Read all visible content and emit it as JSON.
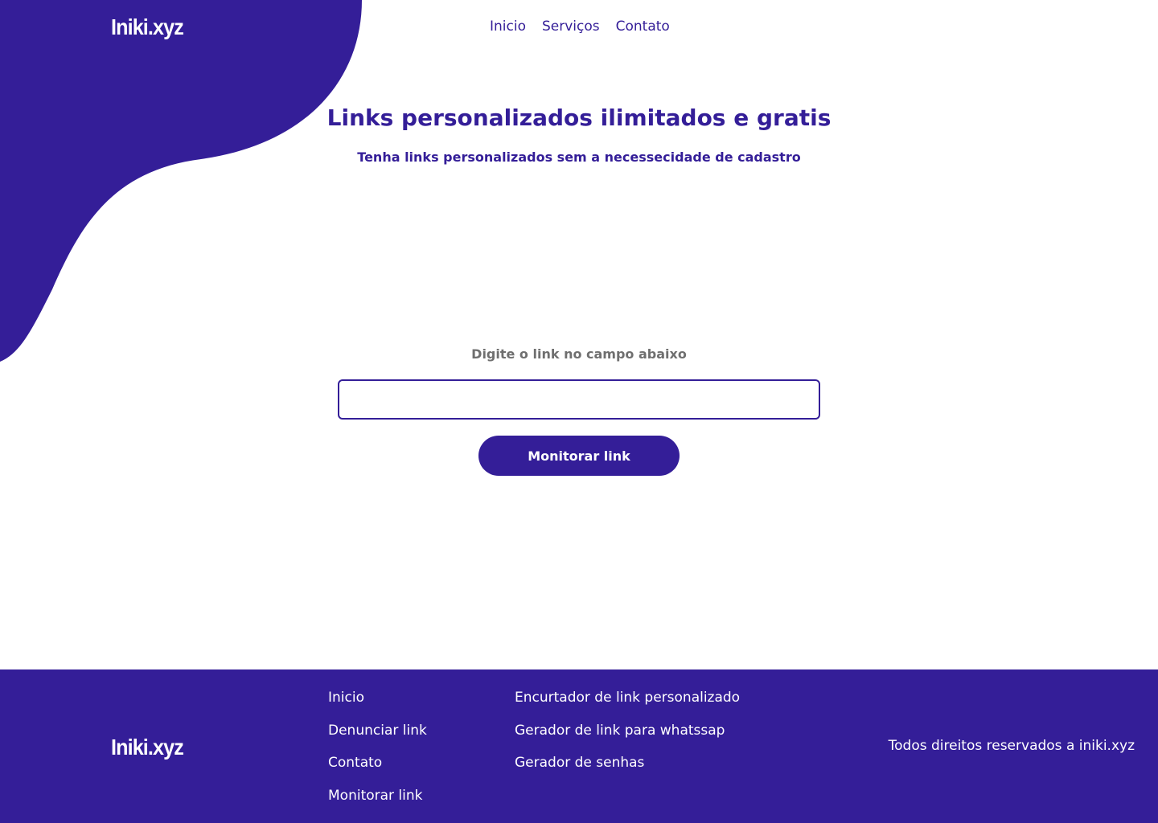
{
  "brand": {
    "name": "Iniki.xyz",
    "primary_color": "#341e98",
    "text_gray": "#6f6f6f"
  },
  "nav": {
    "items": [
      {
        "label": "Inicio"
      },
      {
        "label": "Serviços"
      },
      {
        "label": "Contato"
      }
    ]
  },
  "hero": {
    "title": "Links personalizados ilimitados e gratis",
    "subtitle": "Tenha links personalizados sem a necessecidade de cadastro"
  },
  "form": {
    "label": "Digite o link no campo abaixo",
    "input_value": "",
    "input_placeholder": "",
    "button_label": "Monitorar link"
  },
  "footer": {
    "brand": "Iniki.xyz",
    "col1": [
      {
        "label": "Inicio"
      },
      {
        "label": "Denunciar link"
      },
      {
        "label": "Contato"
      },
      {
        "label": "Monitorar link"
      }
    ],
    "col2": [
      {
        "label": "Encurtador de link personalizado"
      },
      {
        "label": "Gerador de link para whatssap"
      },
      {
        "label": "Gerador de senhas"
      }
    ],
    "copyright": "Todos direitos reservados a iniki.xyz"
  }
}
